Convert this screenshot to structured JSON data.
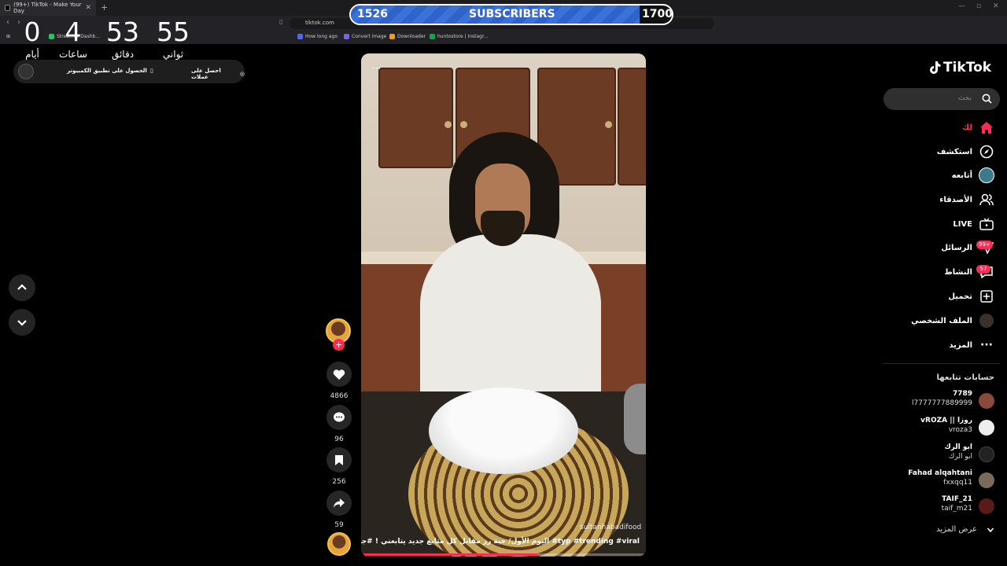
{
  "browser": {
    "tab_title": "(99+) TikTok - Make Your Day",
    "url": "tiktok.com",
    "bookmarks": [
      {
        "label": "Strea...ck Dashb...",
        "color": "#22c55e"
      },
      {
        "label": "How long ago",
        "color": "#4f6bed"
      },
      {
        "label": "Convert image",
        "color": "#7c5cff"
      },
      {
        "label": "Downloader",
        "color": "#f59e0b"
      },
      {
        "label": "huntostore | Instagr...",
        "color": "#16a34a"
      }
    ]
  },
  "overlay": {
    "subscribers": {
      "current": "1526",
      "label": "SUBSCRIBERS",
      "goal": "1700",
      "progress": 0.9
    },
    "countdown": [
      {
        "value": "0",
        "label": "أيام"
      },
      {
        "value": "4",
        "label": "ساعات"
      },
      {
        "value": "53",
        "label": "دقائق"
      },
      {
        "value": "55",
        "label": "ثواني"
      }
    ]
  },
  "promo": {
    "coins_label": "احصل على عملات",
    "app_label": "الحصول على تطبيق الكمبيوتر"
  },
  "video": {
    "username": "sultanhabadifood",
    "caption": "اليوم الأول/ حبة رز مقابل كل متابع جديد يتابعني ! #جيفي #typ #trending #viral",
    "progress": 0.62
  },
  "actions": {
    "likes": "4866",
    "comments": "96",
    "saves": "256",
    "shares": "59"
  },
  "tiktok": {
    "logo": "TikTok",
    "search_placeholder": "بحث",
    "nav": [
      {
        "label": "لك",
        "icon": "home-icon",
        "active": true
      },
      {
        "label": "استكشف",
        "icon": "compass-icon"
      },
      {
        "label": "أتابعه",
        "icon": "following-icon"
      },
      {
        "label": "الأصدقاء",
        "icon": "friends-icon"
      },
      {
        "label": "LIVE",
        "icon": "live-icon"
      },
      {
        "label": "الرسائل",
        "icon": "messages-icon",
        "badge": "99+"
      },
      {
        "label": "النشاط",
        "icon": "activity-icon",
        "badge": "57"
      },
      {
        "label": "تحميل",
        "icon": "upload-icon"
      },
      {
        "label": "الملف الشخصي",
        "icon": "profile-icon"
      },
      {
        "label": "المزيد",
        "icon": "more-icon"
      }
    ],
    "following_title": "حسابات تتابعها",
    "accounts": [
      {
        "name": "7789",
        "handle": "l7777777889999",
        "color": "#8a4a3a"
      },
      {
        "name": "vROZA || روزا",
        "handle": "vroza3",
        "color": "#eeeeee"
      },
      {
        "name": "ابو الرك",
        "handle": "ابو الرك",
        "color": "#222222"
      },
      {
        "name": "Fahad alqahtani",
        "handle": "fxxqq11",
        "color": "#7a6a5a"
      },
      {
        "name": "TAIF_21",
        "handle": "taif_m21",
        "color": "#5a1a1a"
      }
    ],
    "see_more": "عرض المزيد"
  }
}
